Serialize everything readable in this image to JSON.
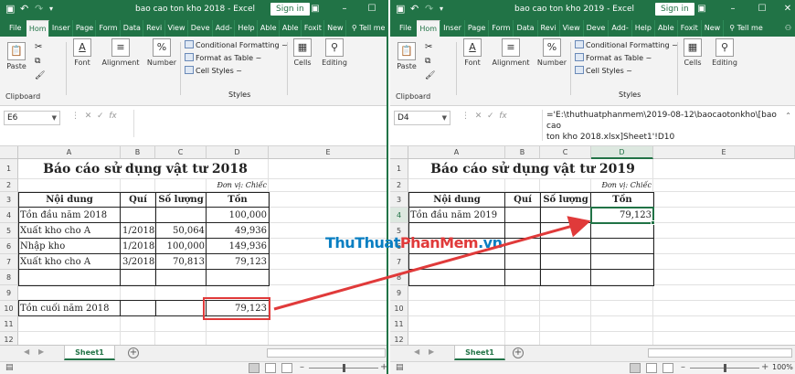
{
  "left": {
    "title": "bao cao ton kho 2018  -  Excel",
    "signin": "Sign in",
    "tabs": [
      "File",
      "Hom",
      "Inser",
      "Page",
      "Form",
      "Data",
      "Revi",
      "View",
      "Deve",
      "Add-",
      "Help",
      "Able",
      "Able",
      "Foxit",
      "New",
      "Tell me"
    ],
    "ribbon": {
      "paste": "Paste",
      "font": "Font",
      "alignment": "Alignment",
      "number": "Number",
      "cond": "Conditional Formatting ~",
      "table": "Format as Table ~",
      "cellstyles": "Cell Styles ~",
      "cells": "Cells",
      "editing": "Editing",
      "clipboard": "Clipboard",
      "styles": "Styles"
    },
    "namebox": "E6",
    "formula": "",
    "cols": [
      "A",
      "B",
      "C",
      "D",
      "E"
    ],
    "rows": [
      "1",
      "2",
      "3",
      "4",
      "5",
      "6",
      "7",
      "8",
      "9",
      "10",
      "11",
      "12"
    ],
    "cells": {
      "title": "Báo cáo sử dụng vật tư 2018",
      "unit": "Đơn vị: Chiếc",
      "h_content": "Nội dung",
      "h_qui": "Quí",
      "h_qty": "Số lượng",
      "h_ton": "Tồn",
      "r4a": "Tồn đầu năm 2018",
      "r4d": "100,000",
      "r5a": "Xuất kho cho A",
      "r5b": "1/2018",
      "r5c": "50,064",
      "r5d": "49,936",
      "r6a": "Nhập kho",
      "r6b": "1/2018",
      "r6c": "100,000",
      "r6d": "149,936",
      "r7a": "Xuất kho cho A",
      "r7b": "3/2018",
      "r7c": "70,813",
      "r7d": "79,123",
      "r10a": "Tồn cuối năm 2018",
      "r10d": "79,123"
    },
    "sheet": "Sheet1"
  },
  "right": {
    "title": "bao cao ton kho 2019  -  Excel",
    "signin": "Sign in",
    "tabs": [
      "File",
      "Hom",
      "Inser",
      "Page",
      "Form",
      "Data",
      "Revi",
      "View",
      "Deve",
      "Add-",
      "Help",
      "Able",
      "Foxit",
      "New",
      "Tell me"
    ],
    "ribbon": {
      "paste": "Paste",
      "font": "Font",
      "alignment": "Alignment",
      "number": "Number",
      "cond": "Conditional Formatting ~",
      "table": "Format as Table ~",
      "cellstyles": "Cell Styles ~",
      "cells": "Cells",
      "editing": "Editing",
      "clipboard": "Clipboard",
      "styles": "Styles"
    },
    "namebox": "D4",
    "formula": "='E:\\thuthuatphanmem\\2019-08-12\\baocaotonkho\\[bao cao\nton kho 2018.xlsx]Sheet1'!D10",
    "cols": [
      "A",
      "B",
      "C",
      "D",
      "E"
    ],
    "rows": [
      "1",
      "2",
      "3",
      "4",
      "5",
      "6",
      "7",
      "8",
      "9",
      "10",
      "11",
      "12"
    ],
    "cells": {
      "title": "Báo cáo sử dụng vật tư 2019",
      "unit": "Đơn vị: Chiếc",
      "h_content": "Nội dung",
      "h_qui": "Quí",
      "h_qty": "Số lượng",
      "h_ton": "Tồn",
      "r4a": "Tồn đầu năm 2019",
      "r4d": "79,123"
    },
    "sheet": "Sheet1",
    "zoom": "100%"
  },
  "watermark": {
    "a": "ThuThuat",
    "b": "PhanMem",
    "c": ".vn"
  },
  "colors": {
    "excel_green": "#217346",
    "arrow": "#e03a3a"
  }
}
